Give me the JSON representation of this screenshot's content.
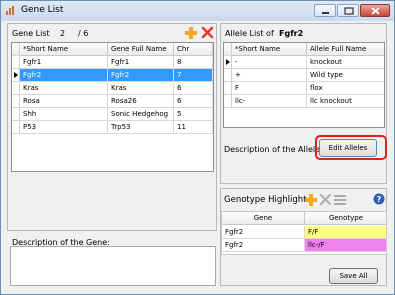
{
  "window": {
    "title": "Gene List"
  },
  "gene_list": {
    "label": "Gene List",
    "current": "2",
    "total": "/ 6",
    "columns": [
      "*Short Name",
      "Gene Full Name",
      "Chr"
    ],
    "rows": [
      [
        "Fgfr1",
        "Fgfr1",
        "8"
      ],
      [
        "Fgfr2",
        "Fgfr2",
        "7"
      ],
      [
        "Kras",
        "Kras",
        "6"
      ],
      [
        "Rosa",
        "Rosa26",
        "6"
      ],
      [
        "Shh",
        "Sonic Hedgehog",
        "5"
      ],
      [
        "P53",
        "Trp53",
        "11"
      ]
    ],
    "selected_index": 1,
    "description_label": "Description of the Gene:"
  },
  "allele_list": {
    "label": "Allele List of",
    "gene": "Fgfr2",
    "columns": [
      "*Short Name",
      "Allele Full Name"
    ],
    "rows": [
      [
        "-",
        "knockout"
      ],
      [
        "+",
        "Wild type"
      ],
      [
        "F",
        "flox"
      ],
      [
        "llc-",
        "llc knockout"
      ]
    ],
    "selected_index": 0,
    "description_label": "Description of the Allele:",
    "edit_button": "Edit Alleles"
  },
  "genotype": {
    "label": "Genotype Highlight",
    "columns": [
      "Gene",
      "Genotype"
    ],
    "rows": [
      {
        "gene": "Fgfr2",
        "genotype": "F/F",
        "color": "#ffff80"
      },
      {
        "gene": "Fgfr2",
        "genotype": "llc-/F",
        "color": "#ee82ee"
      }
    ],
    "save_button": "Save All"
  },
  "icons": [
    "app-icon",
    "add-icon",
    "delete-icon",
    "list-icon",
    "help-icon"
  ],
  "colors": {
    "selection": "#3399ff",
    "highlight_border": "#e02020",
    "add_icon": "#f5a623",
    "delete_icon": "#e53b30"
  }
}
